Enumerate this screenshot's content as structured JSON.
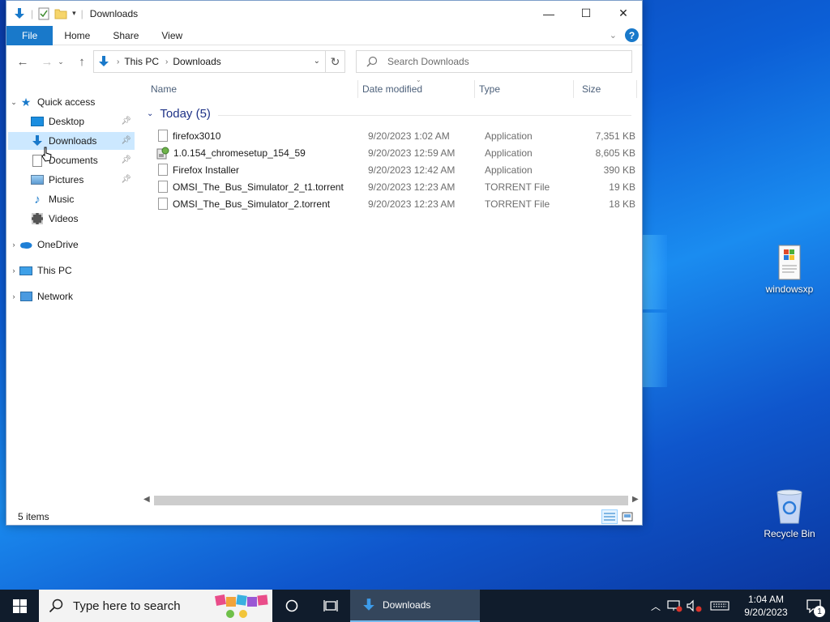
{
  "window": {
    "title": "Downloads",
    "controls": {
      "minimize": "—",
      "maximize": "☐",
      "close": "✕"
    }
  },
  "ribbon": {
    "tabs": [
      "File",
      "Home",
      "Share",
      "View"
    ],
    "help": "?"
  },
  "address": {
    "crumbs": [
      "This PC",
      "Downloads"
    ],
    "search_placeholder": "Search Downloads"
  },
  "nav_pane": {
    "quick_access": "Quick access",
    "items": [
      {
        "label": "Desktop",
        "icon": "desktop-icon",
        "pinned": true
      },
      {
        "label": "Downloads",
        "icon": "downloads-icon",
        "pinned": true,
        "selected": true
      },
      {
        "label": "Documents",
        "icon": "documents-icon",
        "pinned": true
      },
      {
        "label": "Pictures",
        "icon": "pictures-icon",
        "pinned": true
      },
      {
        "label": "Music",
        "icon": "music-icon",
        "pinned": false
      },
      {
        "label": "Videos",
        "icon": "videos-icon",
        "pinned": false
      }
    ],
    "roots": [
      {
        "label": "OneDrive",
        "icon": "onedrive-icon"
      },
      {
        "label": "This PC",
        "icon": "this-pc-icon"
      },
      {
        "label": "Network",
        "icon": "network-icon"
      }
    ]
  },
  "file_list": {
    "columns": [
      "Name",
      "Date modified",
      "Type",
      "Size"
    ],
    "group": "Today (5)",
    "rows": [
      {
        "name": "firefox3010",
        "date": "9/20/2023 1:02 AM",
        "type": "Application",
        "size": "7,351 KB",
        "icon": "blank-file-icon"
      },
      {
        "name": "1.0.154_chromesetup_154_59",
        "date": "9/20/2023 12:59 AM",
        "type": "Application",
        "size": "8,605 KB",
        "icon": "installer-icon"
      },
      {
        "name": "Firefox Installer",
        "date": "9/20/2023 12:42 AM",
        "type": "Application",
        "size": "390 KB",
        "icon": "blank-file-icon"
      },
      {
        "name": "OMSI_The_Bus_Simulator_2_t1.torrent",
        "date": "9/20/2023 12:23 AM",
        "type": "TORRENT File",
        "size": "19 KB",
        "icon": "blank-file-icon"
      },
      {
        "name": "OMSI_The_Bus_Simulator_2.torrent",
        "date": "9/20/2023 12:23 AM",
        "type": "TORRENT File",
        "size": "18 KB",
        "icon": "blank-file-icon"
      }
    ]
  },
  "status": {
    "items": "5 items"
  },
  "desktop": {
    "icons": [
      {
        "label": "windowsxp",
        "icon": "windowsxp-icon"
      },
      {
        "label": "Recycle Bin",
        "icon": "recycle-bin-icon"
      }
    ]
  },
  "taskbar": {
    "search_placeholder": "Type here to search",
    "active_app": "Downloads",
    "time": "1:04 AM",
    "date": "9/20/2023",
    "notifications": "1"
  },
  "colors": {
    "accent": "#1979ca",
    "selection": "#cce8ff",
    "group_header": "#1e3287",
    "taskbar": "#101c2c"
  }
}
